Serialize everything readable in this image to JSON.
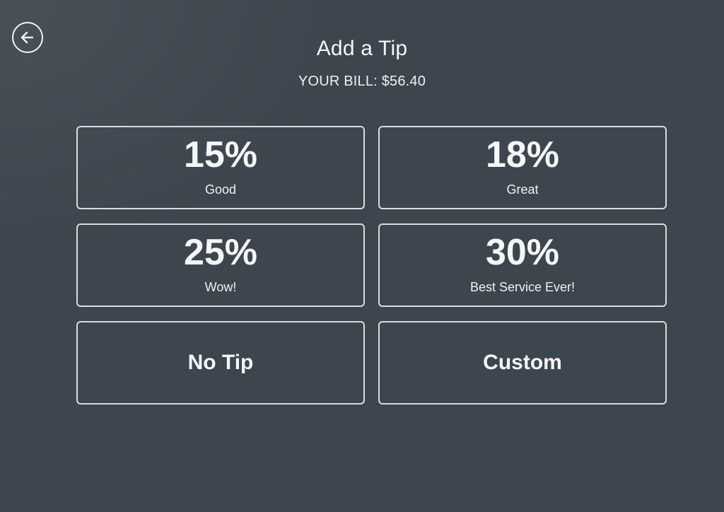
{
  "header": {
    "back_icon": "back-arrow-icon",
    "title": "Add a Tip",
    "bill": "YOUR BILL: $56.40"
  },
  "tip_options": [
    {
      "percent": "15%",
      "caption": "Good"
    },
    {
      "percent": "18%",
      "caption": "Great"
    },
    {
      "percent": "25%",
      "caption": "Wow!"
    },
    {
      "percent": "30%",
      "caption": "Best Service Ever!"
    }
  ],
  "other_options": {
    "no_tip": "No Tip",
    "custom": "Custom"
  },
  "colors": {
    "background": "#3d464e",
    "foreground": "#f4f6f7",
    "border": "#d8dde0"
  }
}
